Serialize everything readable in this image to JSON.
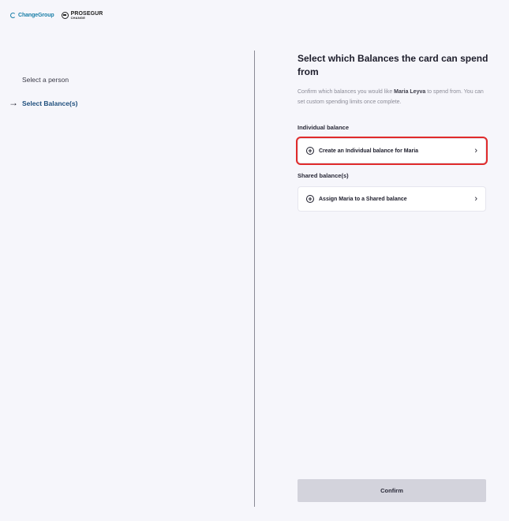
{
  "brand": {
    "changegroup": "ChangeGroup",
    "prosegur_line1": "PROSEGUR",
    "prosegur_line2": "CHANGE"
  },
  "steps": [
    {
      "label": "Select a person",
      "active": false
    },
    {
      "label": "Select Balance(s)",
      "active": true
    }
  ],
  "main": {
    "title": "Select which Balances the card can spend from",
    "desc_prefix": "Confirm which balances you would like ",
    "desc_name": "Maria Leyva",
    "desc_suffix": " to spend from. You can set custom spending limits once complete.",
    "individual_label": "Individual balance",
    "individual_option": "Create an Individual balance for Maria",
    "shared_label": "Shared balance(s)",
    "shared_option": "Assign Maria to a Shared balance",
    "confirm_label": "Confirm"
  },
  "icons": {
    "step_arrow": "arrow-right-icon",
    "option_plus": "plus-circle-icon",
    "option_chevron": "chevron-right-icon"
  },
  "colors": {
    "background": "#f6f6fb",
    "active_step": "#1f4f7d",
    "highlight": "#e02b2b",
    "confirm_bg": "#d3d3dc"
  }
}
